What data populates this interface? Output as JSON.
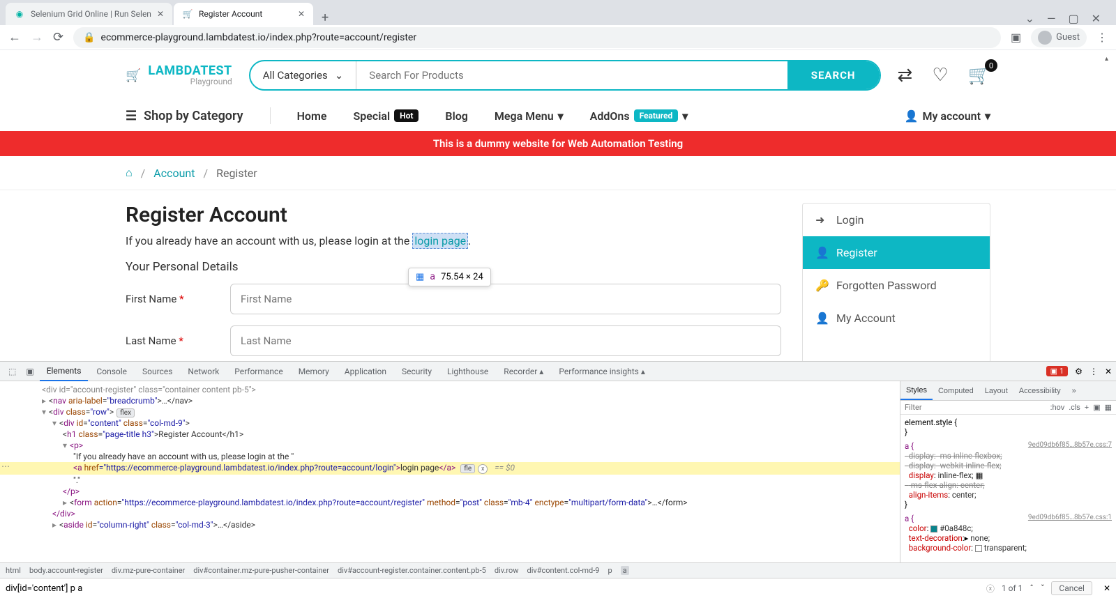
{
  "browser": {
    "tabs": [
      {
        "title": "Selenium Grid Online | Run Selen",
        "favicon": "◷"
      },
      {
        "title": "Register Account",
        "favicon": "🛒"
      }
    ],
    "newTab": "+",
    "windowControls": {
      "dropdown": "⌄",
      "min": "—",
      "max": "▢",
      "close": "✕"
    },
    "nav": {
      "back": "←",
      "forward": "→",
      "reload": "⟳"
    },
    "url": "ecommerce-playground.lambdatest.io/index.php?route=account/register",
    "guest": "Guest"
  },
  "header": {
    "logoMain": "LAMBDATEST",
    "logoSub": "Playground",
    "categorySelect": "All Categories",
    "searchPlaceholder": "Search For Products",
    "searchButton": "SEARCH",
    "cartCount": "0"
  },
  "nav": {
    "shopByCategory": "Shop by Category",
    "items": {
      "home": "Home",
      "special": "Special",
      "specialBadge": "Hot",
      "blog": "Blog",
      "mega": "Mega Menu",
      "addons": "AddOns",
      "addonsBadge": "Featured",
      "account": "My account"
    }
  },
  "banner": "This is a dummy website for Web Automation Testing",
  "breadcrumb": {
    "home": "⌂",
    "account": "Account",
    "register": "Register",
    "sep": "/"
  },
  "content": {
    "title": "Register Account",
    "intro": "If you already have an account with us, please login at the ",
    "loginLink": "login page",
    "period": ".",
    "personalDetails": "Your Personal Details",
    "firstNameLabel": "First Name",
    "firstNamePlaceholder": "First Name",
    "lastNameLabel": "Last Name",
    "lastNamePlaceholder": "Last Name"
  },
  "tooltip": {
    "tag": "a",
    "dims": "75.54 × 24"
  },
  "sidebar": {
    "items": [
      {
        "label": "Login",
        "icon": "➜"
      },
      {
        "label": "Register",
        "icon": "👤",
        "active": true
      },
      {
        "label": "Forgotten Password",
        "icon": "🔑"
      },
      {
        "label": "My Account",
        "icon": "👤"
      }
    ]
  },
  "devtools": {
    "tabs": [
      "Elements",
      "Console",
      "Sources",
      "Network",
      "Performance",
      "Memory",
      "Application",
      "Security",
      "Lighthouse",
      "Recorder ▴",
      "Performance insights ▴"
    ],
    "activeTab": "Elements",
    "errorCount": "1",
    "dom": {
      "l0": "<div id=\"account-register\" class=\"container content pb-5\">",
      "l1a": "nav",
      "l1b": "aria-label",
      "l1c": "\"breadcrumb\"",
      "l1d": "…</nav>",
      "l2a": "div",
      "l2b": "class",
      "l2c": "\"row\"",
      "l2badge": "flex",
      "l3a": "div",
      "l3b": "id",
      "l3c": "\"content\"",
      "l3d": "class",
      "l3e": "\"col-md-9\"",
      "l4a": "h1",
      "l4b": "class",
      "l4c": "\"page-title h3\"",
      "l4txt": "Register Account",
      "l4end": "</h1>",
      "l5": "<p>",
      "l6": "\"If you already have an account with us, please login at the \"",
      "l7a": "<a ",
      "l7b": "href",
      "l7c": "=\"https://ecommerce-playground.lambdatest.io/index.php?route=account/login\"",
      "l7d": ">",
      "l7txt": "login page",
      "l7e": "</a>",
      "l7flex": "fle",
      "l7eq": "== $0",
      "l8": "\".\"",
      "l9": "</p>",
      "l10a": "form",
      "l10b": "action",
      "l10c": "\"https://ecommerce-playground.lambdatest.io/index.php?route=account/register\"",
      "l10d": "method",
      "l10e": "\"post\"",
      "l10f": "class",
      "l10g": "\"mb-4\"",
      "l10h": "enctype",
      "l10i": "\"multipart/form-data\"",
      "l10j": "…</form>",
      "l11": "</div>",
      "l12a": "aside",
      "l12b": "id",
      "l12c": "\"column-right\"",
      "l12d": "class",
      "l12e": "\"col-md-3\"",
      "l12f": "…</aside>"
    },
    "sideTabs": [
      "Styles",
      "Computed",
      "Layout",
      "Accessibility"
    ],
    "filterPlaceholder": "Filter",
    "filterBtns": {
      "hov": ":hov",
      "cls": ".cls",
      "plus": "+"
    },
    "styles": {
      "elstyle": "element.style {",
      "cssFile": "9ed09db6f85…8b57e.css:7",
      "cssFile2": "9ed09db6f85…8b57e.css:1",
      "selA": "a {",
      "p1": "display",
      "v1": "-ms-inline-flexbox;",
      "p2": "display",
      "v2": "-webkit-inline-flex;",
      "p3": "display",
      "v3": "inline-flex;",
      "p4": "-ms-flex-align",
      "v4": "center;",
      "p5": "align-items",
      "v5": "center;",
      "p6": "color",
      "v6": "#0a848c;",
      "p7": "text-decoration",
      "v7": "none;",
      "p8": "background-color",
      "v8": "transparent;"
    },
    "crumbs": [
      "html",
      "body.account-register",
      "div.mz-pure-container",
      "div#container.mz-pure-pusher-container",
      "div#account-register.container.content.pb-5",
      "div.row",
      "div#content.col-md-9",
      "p",
      "a"
    ],
    "search": {
      "value": "div[id='content'] p a",
      "count": "1 of 1",
      "cancel": "Cancel"
    }
  }
}
